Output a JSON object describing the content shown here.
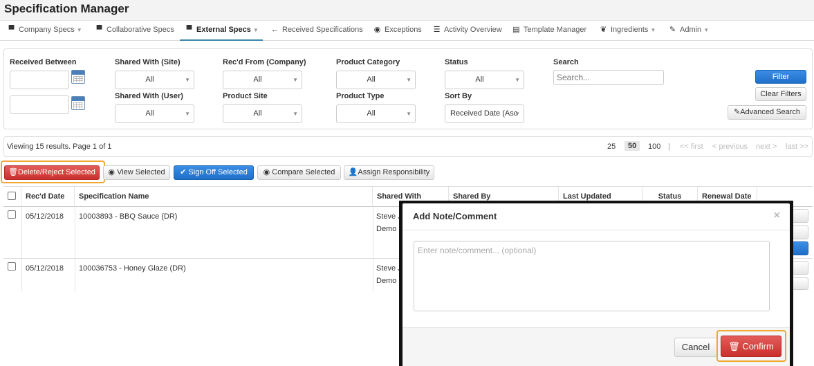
{
  "app": {
    "title": "Specification Manager"
  },
  "nav": {
    "items": [
      {
        "label": "Company Specs",
        "icon": "briefcase-icon",
        "glyph": "▀",
        "caret": "▼"
      },
      {
        "label": "Collaborative Specs",
        "icon": "briefcase-icon",
        "glyph": "▀",
        "caret": ""
      },
      {
        "label": "External Specs",
        "icon": "briefcase-icon",
        "glyph": "▀",
        "caret": "▼",
        "active": true
      },
      {
        "label": "Received Specifications",
        "icon": "arrow-left-icon",
        "glyph": "←",
        "caret": ""
      },
      {
        "label": "Exceptions",
        "icon": "circle-check-icon",
        "glyph": "◉",
        "caret": ""
      },
      {
        "label": "Activity Overview",
        "icon": "list-icon",
        "glyph": "☰",
        "caret": ""
      },
      {
        "label": "Template Manager",
        "icon": "list-alt-icon",
        "glyph": "▤",
        "caret": ""
      },
      {
        "label": "Ingredients",
        "icon": "leaf-icon",
        "glyph": "❦",
        "caret": "▼"
      },
      {
        "label": "Admin",
        "icon": "wrench-icon",
        "glyph": "✎",
        "caret": "▼"
      }
    ]
  },
  "filters": {
    "received_between_label": "Received Between",
    "shared_site_label": "Shared With (Site)",
    "shared_site_value": "All",
    "shared_user_label": "Shared With (User)",
    "shared_user_value": "All",
    "recd_from_label": "Rec'd From (Company)",
    "recd_from_value": "All",
    "product_site_label": "Product Site",
    "product_site_value": "All",
    "product_category_label": "Product Category",
    "product_category_value": "All",
    "product_type_label": "Product Type",
    "product_type_value": "All",
    "status_label": "Status",
    "status_value": "All",
    "sort_by_label": "Sort By",
    "sort_by_value": "Received Date (Asc",
    "search_label": "Search",
    "search_placeholder": "Search...",
    "filter_button": "Filter",
    "clear_button": "Clear Filters",
    "advanced_button": "Advanced Search",
    "select_caret": "▼"
  },
  "results": {
    "summary": "Viewing 15 results. Page 1 of 1",
    "page_sizes": [
      "25",
      "50",
      "100"
    ],
    "active_page_size": "50",
    "separator": "|",
    "first": "<< first",
    "previous": "< previous",
    "next": "next >",
    "last": "last >>"
  },
  "actions": {
    "delete": "Delete/Reject Selected",
    "view": "View Selected",
    "signoff": "Sign Off Selected",
    "compare": "Compare Selected",
    "assign": "Assign Responsibility"
  },
  "table": {
    "headers": [
      "Rec'd Date",
      "Specification Name",
      "Shared With",
      "Shared By",
      "Last Updated",
      "Status",
      "Renewal Date"
    ],
    "rows": [
      {
        "date": "05/12/2018",
        "name": "10003893 - BBQ Sauce (DR)",
        "shared_with_1": "Steve J",
        "shared_with_2": "Demo"
      },
      {
        "date": "05/12/2018",
        "name": "100036753 - Honey Glaze (DR)",
        "shared_with_1": "Steve J",
        "shared_with_2": "Demo"
      }
    ]
  },
  "modal": {
    "title": "Add Note/Comment",
    "close": "×",
    "placeholder": "Enter note/comment... (optional)",
    "cancel": "Cancel",
    "confirm": "Confirm"
  },
  "colors": {
    "primary": "#2b7fd8",
    "danger": "#d43f3a",
    "highlight": "#f0a830"
  }
}
